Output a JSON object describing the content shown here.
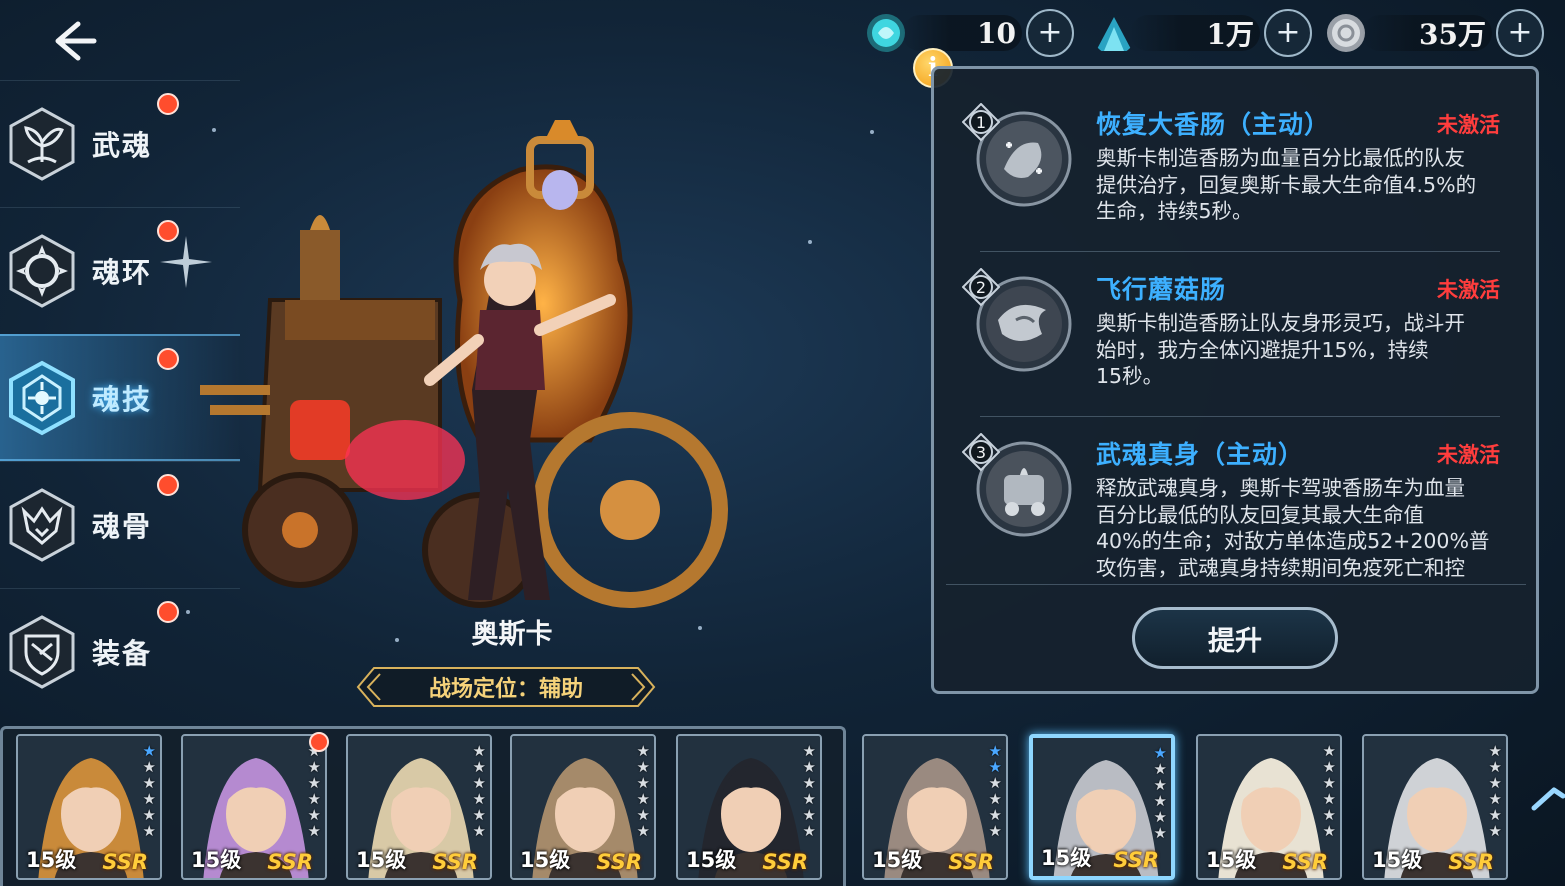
{
  "currencies": [
    {
      "name": "soul-crystal",
      "value": "10",
      "color": "#3fd6e0"
    },
    {
      "name": "blue-spirit",
      "value": "1万",
      "color": "#39b8d8"
    },
    {
      "name": "silver-coin",
      "value": "35万",
      "color": "#c7ccd2"
    }
  ],
  "nav": {
    "items": [
      {
        "label": "武魂",
        "icon": "sprout-icon",
        "badge": true
      },
      {
        "label": "魂环",
        "icon": "ring-icon",
        "badge": true
      },
      {
        "label": "魂技",
        "icon": "skill-icon",
        "badge": true,
        "active": true
      },
      {
        "label": "魂骨",
        "icon": "bone-icon",
        "badge": true
      },
      {
        "label": "装备",
        "icon": "equipment-icon",
        "badge": true
      }
    ]
  },
  "character": {
    "name": "奥斯卡",
    "role": "战场定位：辅助"
  },
  "info": {
    "label": "i"
  },
  "skills": [
    {
      "number": "1",
      "title": "恢复大香肠（主动）",
      "status": "未激活",
      "desc": [
        "奥斯卡制造香肠为血量百分比最低的队友",
        "提供治疗，回复奥斯卡最大生命值4.5%的",
        "生命，持续5秒。"
      ]
    },
    {
      "number": "2",
      "title": "飞行蘑菇肠",
      "status": "未激活",
      "desc": [
        "奥斯卡制造香肠让队友身形灵巧，战斗开",
        "始时，我方全体闪避提升15%，持续",
        "15秒。"
      ]
    },
    {
      "number": "3",
      "title": "武魂真身（主动）",
      "status": "未激活",
      "desc": [
        "释放武魂真身，奥斯卡驾驶香肠车为血量",
        "百分比最低的队友回复其最大生命值",
        "40%的生命；对敌方单体造成52+200%普",
        "攻伤害，武魂真身持续期间免疫死亡和控"
      ]
    }
  ],
  "upgrade_label": "提升",
  "roster": [
    {
      "level": "15级",
      "rarity": "SSR",
      "stars": 6,
      "blue_stars": 1,
      "hair": "#c98a3a",
      "badge": false
    },
    {
      "level": "15级",
      "rarity": "SSR",
      "stars": 6,
      "blue_stars": 0,
      "hair": "#b58ad0",
      "badge": true
    },
    {
      "level": "15级",
      "rarity": "SSR",
      "stars": 6,
      "blue_stars": 0,
      "hair": "#d8c9a6",
      "badge": false
    },
    {
      "level": "15级",
      "rarity": "SSR",
      "stars": 6,
      "blue_stars": 0,
      "hair": "#a58a6a",
      "badge": false
    },
    {
      "level": "15级",
      "rarity": "SSR",
      "stars": 6,
      "blue_stars": 0,
      "hair": "#23262e",
      "badge": false
    },
    {
      "level": "15级",
      "rarity": "SSR",
      "stars": 6,
      "blue_stars": 2,
      "hair": "#9a8a80",
      "badge": false
    },
    {
      "level": "15级",
      "rarity": "SSR",
      "stars": 6,
      "blue_stars": 1,
      "hair": "#b9bcc3",
      "badge": false,
      "selected": true
    },
    {
      "level": "15级",
      "rarity": "SSR",
      "stars": 6,
      "blue_stars": 0,
      "hair": "#e8e2d3",
      "badge": false
    },
    {
      "level": "15级",
      "rarity": "SSR",
      "stars": 6,
      "blue_stars": 0,
      "hair": "#cfd2d6",
      "badge": false
    }
  ]
}
